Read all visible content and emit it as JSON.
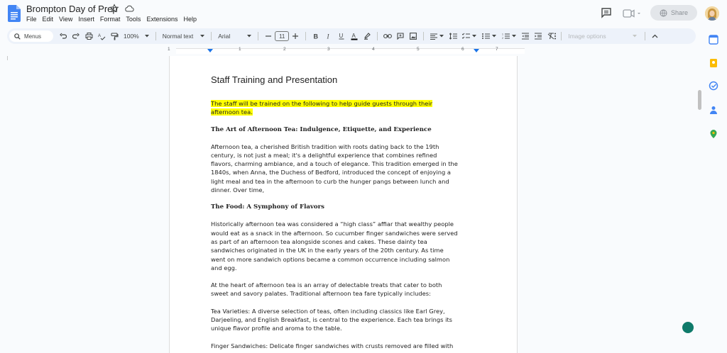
{
  "doc": {
    "title": "Brompton Day of Prep",
    "menu": [
      "File",
      "Edit",
      "View",
      "Insert",
      "Format",
      "Tools",
      "Extensions",
      "Help"
    ]
  },
  "header": {
    "share_label": "Share"
  },
  "toolbar": {
    "menus_label": "Menus",
    "zoom": "100%",
    "style": "Normal text",
    "font": "Arial",
    "font_size": "11",
    "image_options": "Image options"
  },
  "ruler": {
    "numbers": [
      "1",
      "1",
      "2",
      "3",
      "4",
      "5",
      "6",
      "7"
    ]
  },
  "content": {
    "heading": "Staff Training and Presentation",
    "intro_line1": "The staff will be trained on the following to help guide guests through their",
    "intro_line2": "afternoon tea.",
    "section1_title": "The Art of Afternoon Tea: Indulgence, Etiquette, and Experience",
    "section1_body": [
      "Afternoon tea, a cherished British tradition with roots dating back to the 19th",
      "century, is not just a meal; it's a delightful experience that combines refined",
      "flavors, charming ambiance, and a touch of elegance. This tradition emerged in the",
      "1840s, when Anna, the Duchess of Bedford, introduced the concept of enjoying a",
      "light meal and tea in the afternoon to curb the hunger pangs between lunch and",
      "dinner. Over time,"
    ],
    "section2_title": "The Food: A Symphony of Flavors",
    "section2_body": [
      "Historically afternoon tea was considered a “high class” affiar that wealthy people",
      "would eat as a snack in the afternoon. So cucumber finger sandwiches were served",
      "as part of an afternoon tea alongside scones and cakes. These dainty tea",
      "sandwiches originated in the UK in the early years of the 20th century. As time",
      "went on more sandwich options became a common occurrence including salmon",
      "and egg."
    ],
    "para3": [
      "At the heart of afternoon tea is an array of delectable treats that cater to both",
      "sweet and savory palates. Traditional afternoon tea fare typically includes:"
    ],
    "para4": [
      "Tea Varieties: A diverse selection of teas, often including classics like Earl Grey,",
      "Darjeeling, and English Breakfast, is central to the experience. Each tea brings its",
      "unique flavor profile and aroma to the table."
    ],
    "para5": [
      "Finger Sandwiches: Delicate finger sandwiches with crusts removed are filled with"
    ]
  },
  "colors": {
    "accent": "#1a73e8",
    "highlight": "#ffff00",
    "fab": "#0f7a6a"
  }
}
